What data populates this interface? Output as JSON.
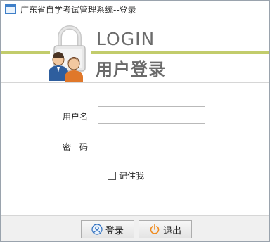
{
  "window": {
    "title": "广东省自学考试管理系统--登录"
  },
  "header": {
    "title": "LOGIN",
    "subtitle": "用户登录"
  },
  "form": {
    "username_label": "用户名",
    "username_value": "",
    "password_label": "密　码",
    "password_value": "",
    "remember_label": "记住我",
    "remember_checked": false
  },
  "footer": {
    "login_label": "登录",
    "exit_label": "退出"
  },
  "colors": {
    "accent_green": "#c2cc6b",
    "login_icon_blue": "#2e6fbf",
    "exit_icon_orange": "#f08a1c"
  }
}
